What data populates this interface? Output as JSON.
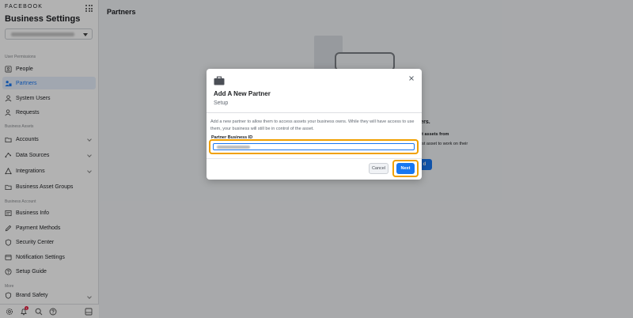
{
  "sidebar": {
    "brand": "FACEBOOK",
    "app_title": "Business Settings",
    "sections": {
      "user_permissions": "User Permissions",
      "business_assets": "Business Assets",
      "business_account": "Business Account",
      "more": "More"
    },
    "items": {
      "people": "People",
      "partners": "Partners",
      "system_users": "System Users",
      "requests": "Requests",
      "accounts": "Accounts",
      "data_sources": "Data Sources",
      "integrations": "Integrations",
      "business_asset_groups": "Business Asset Groups",
      "business_info": "Business Info",
      "payment_methods": "Payment Methods",
      "security_center": "Security Center",
      "notification_settings": "Notification Settings",
      "setup_guide": "Setup Guide",
      "brand_safety": "Brand Safety"
    },
    "notification_count": "1"
  },
  "main": {
    "title": "Partners",
    "empty_heading": "ners.",
    "empty_sub": "est assets from",
    "empty_desc": "uest asset to work on their\nnt.",
    "empty_button": "d"
  },
  "modal": {
    "title": "Add A New Partner",
    "step": "Setup",
    "description": "Add a new partner to allow them to access assets your business owns. While they will have access to use them, your business will still be in control of the asset.",
    "field_label": "Partner Business ID",
    "cancel_label": "Cancel",
    "next_label": "Next"
  },
  "colors": {
    "accent": "#1877f2",
    "highlight": "#f0a000"
  }
}
